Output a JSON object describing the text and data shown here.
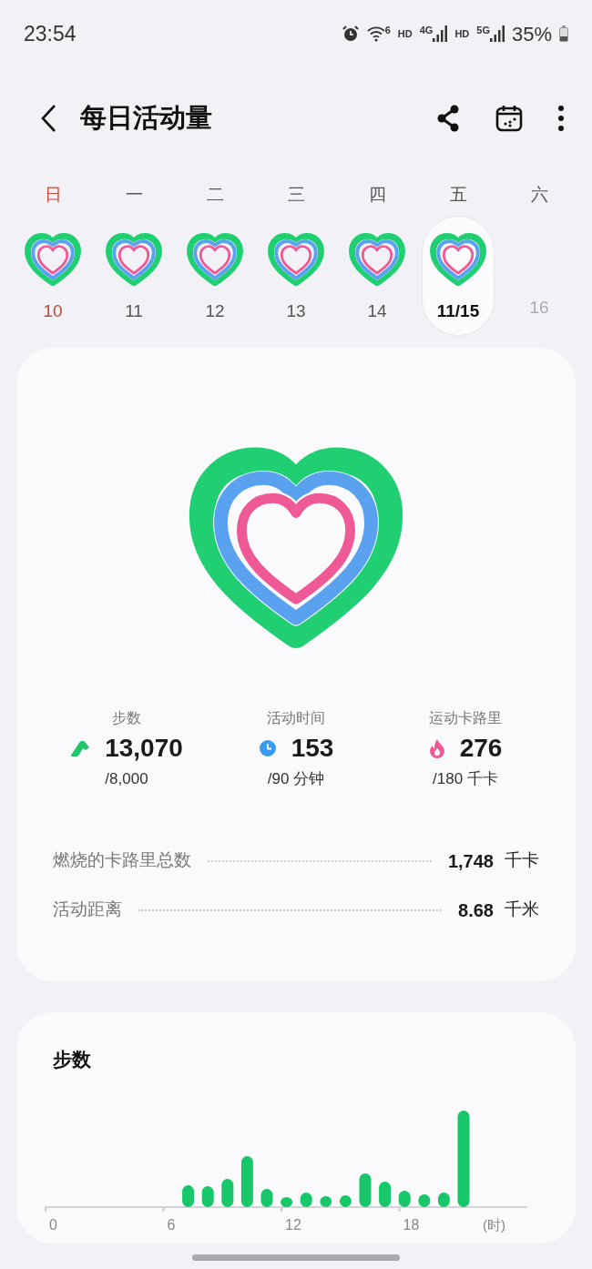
{
  "status_bar": {
    "time": "23:54",
    "indicators": [
      {
        "kind": "alarm"
      },
      {
        "kind": "wifi",
        "text": "6"
      },
      {
        "kind": "hd",
        "text": "HD"
      },
      {
        "kind": "signal",
        "text": "4G"
      },
      {
        "kind": "hd",
        "text": "HD"
      },
      {
        "kind": "signal",
        "text": "5G"
      }
    ],
    "battery": "35%"
  },
  "header": {
    "title": "每日活动量"
  },
  "week": [
    {
      "weekday": "日",
      "date": "10",
      "kind": "sunday",
      "selected": false
    },
    {
      "weekday": "一",
      "date": "11",
      "kind": "weekday",
      "selected": false
    },
    {
      "weekday": "二",
      "date": "12",
      "kind": "weekday",
      "selected": false
    },
    {
      "weekday": "三",
      "date": "13",
      "kind": "weekday",
      "selected": false
    },
    {
      "weekday": "四",
      "date": "14",
      "kind": "weekday",
      "selected": false
    },
    {
      "weekday": "五",
      "date": "11/15",
      "kind": "weekday",
      "selected": true
    },
    {
      "weekday": "六",
      "date": "16",
      "kind": "future",
      "selected": false
    }
  ],
  "stats": [
    {
      "kind": "steps",
      "label": "步数",
      "value": "13,070",
      "goal": "/8,000"
    },
    {
      "kind": "time",
      "label": "活动时间",
      "value": "153",
      "goal": "/90 分钟"
    },
    {
      "kind": "calories",
      "label": "运动卡路里",
      "value": "276",
      "goal": "/180 千卡"
    }
  ],
  "summary": [
    {
      "label": "燃烧的卡路里总数",
      "value": "1,748",
      "unit": "千卡"
    },
    {
      "label": "活动距离",
      "value": "8.68",
      "unit": "千米"
    }
  ],
  "steps_card": {
    "title": "步数",
    "x_ticks": [
      "0",
      "6",
      "12",
      "18"
    ],
    "x_unit": "(时)"
  }
}
